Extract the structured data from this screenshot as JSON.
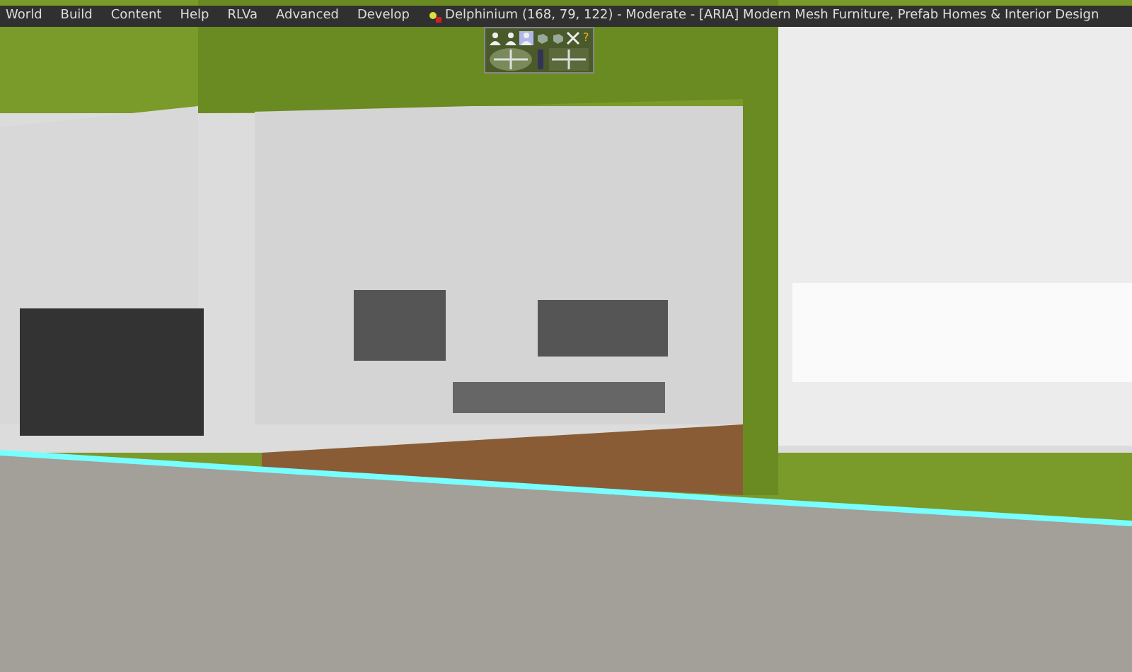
{
  "menu_bar": {
    "items": [
      {
        "label": "World"
      },
      {
        "label": "Build"
      },
      {
        "label": "Content"
      },
      {
        "label": "Help"
      },
      {
        "label": "RLVa"
      },
      {
        "label": "Advanced"
      },
      {
        "label": "Develop"
      }
    ],
    "location": "Delphinium (168, 79, 122) - Moderate - [ARIA] Modern Mesh Furniture, Prefab Homes & Interior Design"
  },
  "camera_controls": {
    "modes": [
      {
        "kind": "person",
        "selected": false
      },
      {
        "kind": "person",
        "selected": false
      },
      {
        "kind": "person",
        "selected": true
      },
      {
        "kind": "object",
        "selected": false
      },
      {
        "kind": "object",
        "selected": false
      },
      {
        "kind": "close",
        "selected": false
      }
    ],
    "help": "?"
  }
}
